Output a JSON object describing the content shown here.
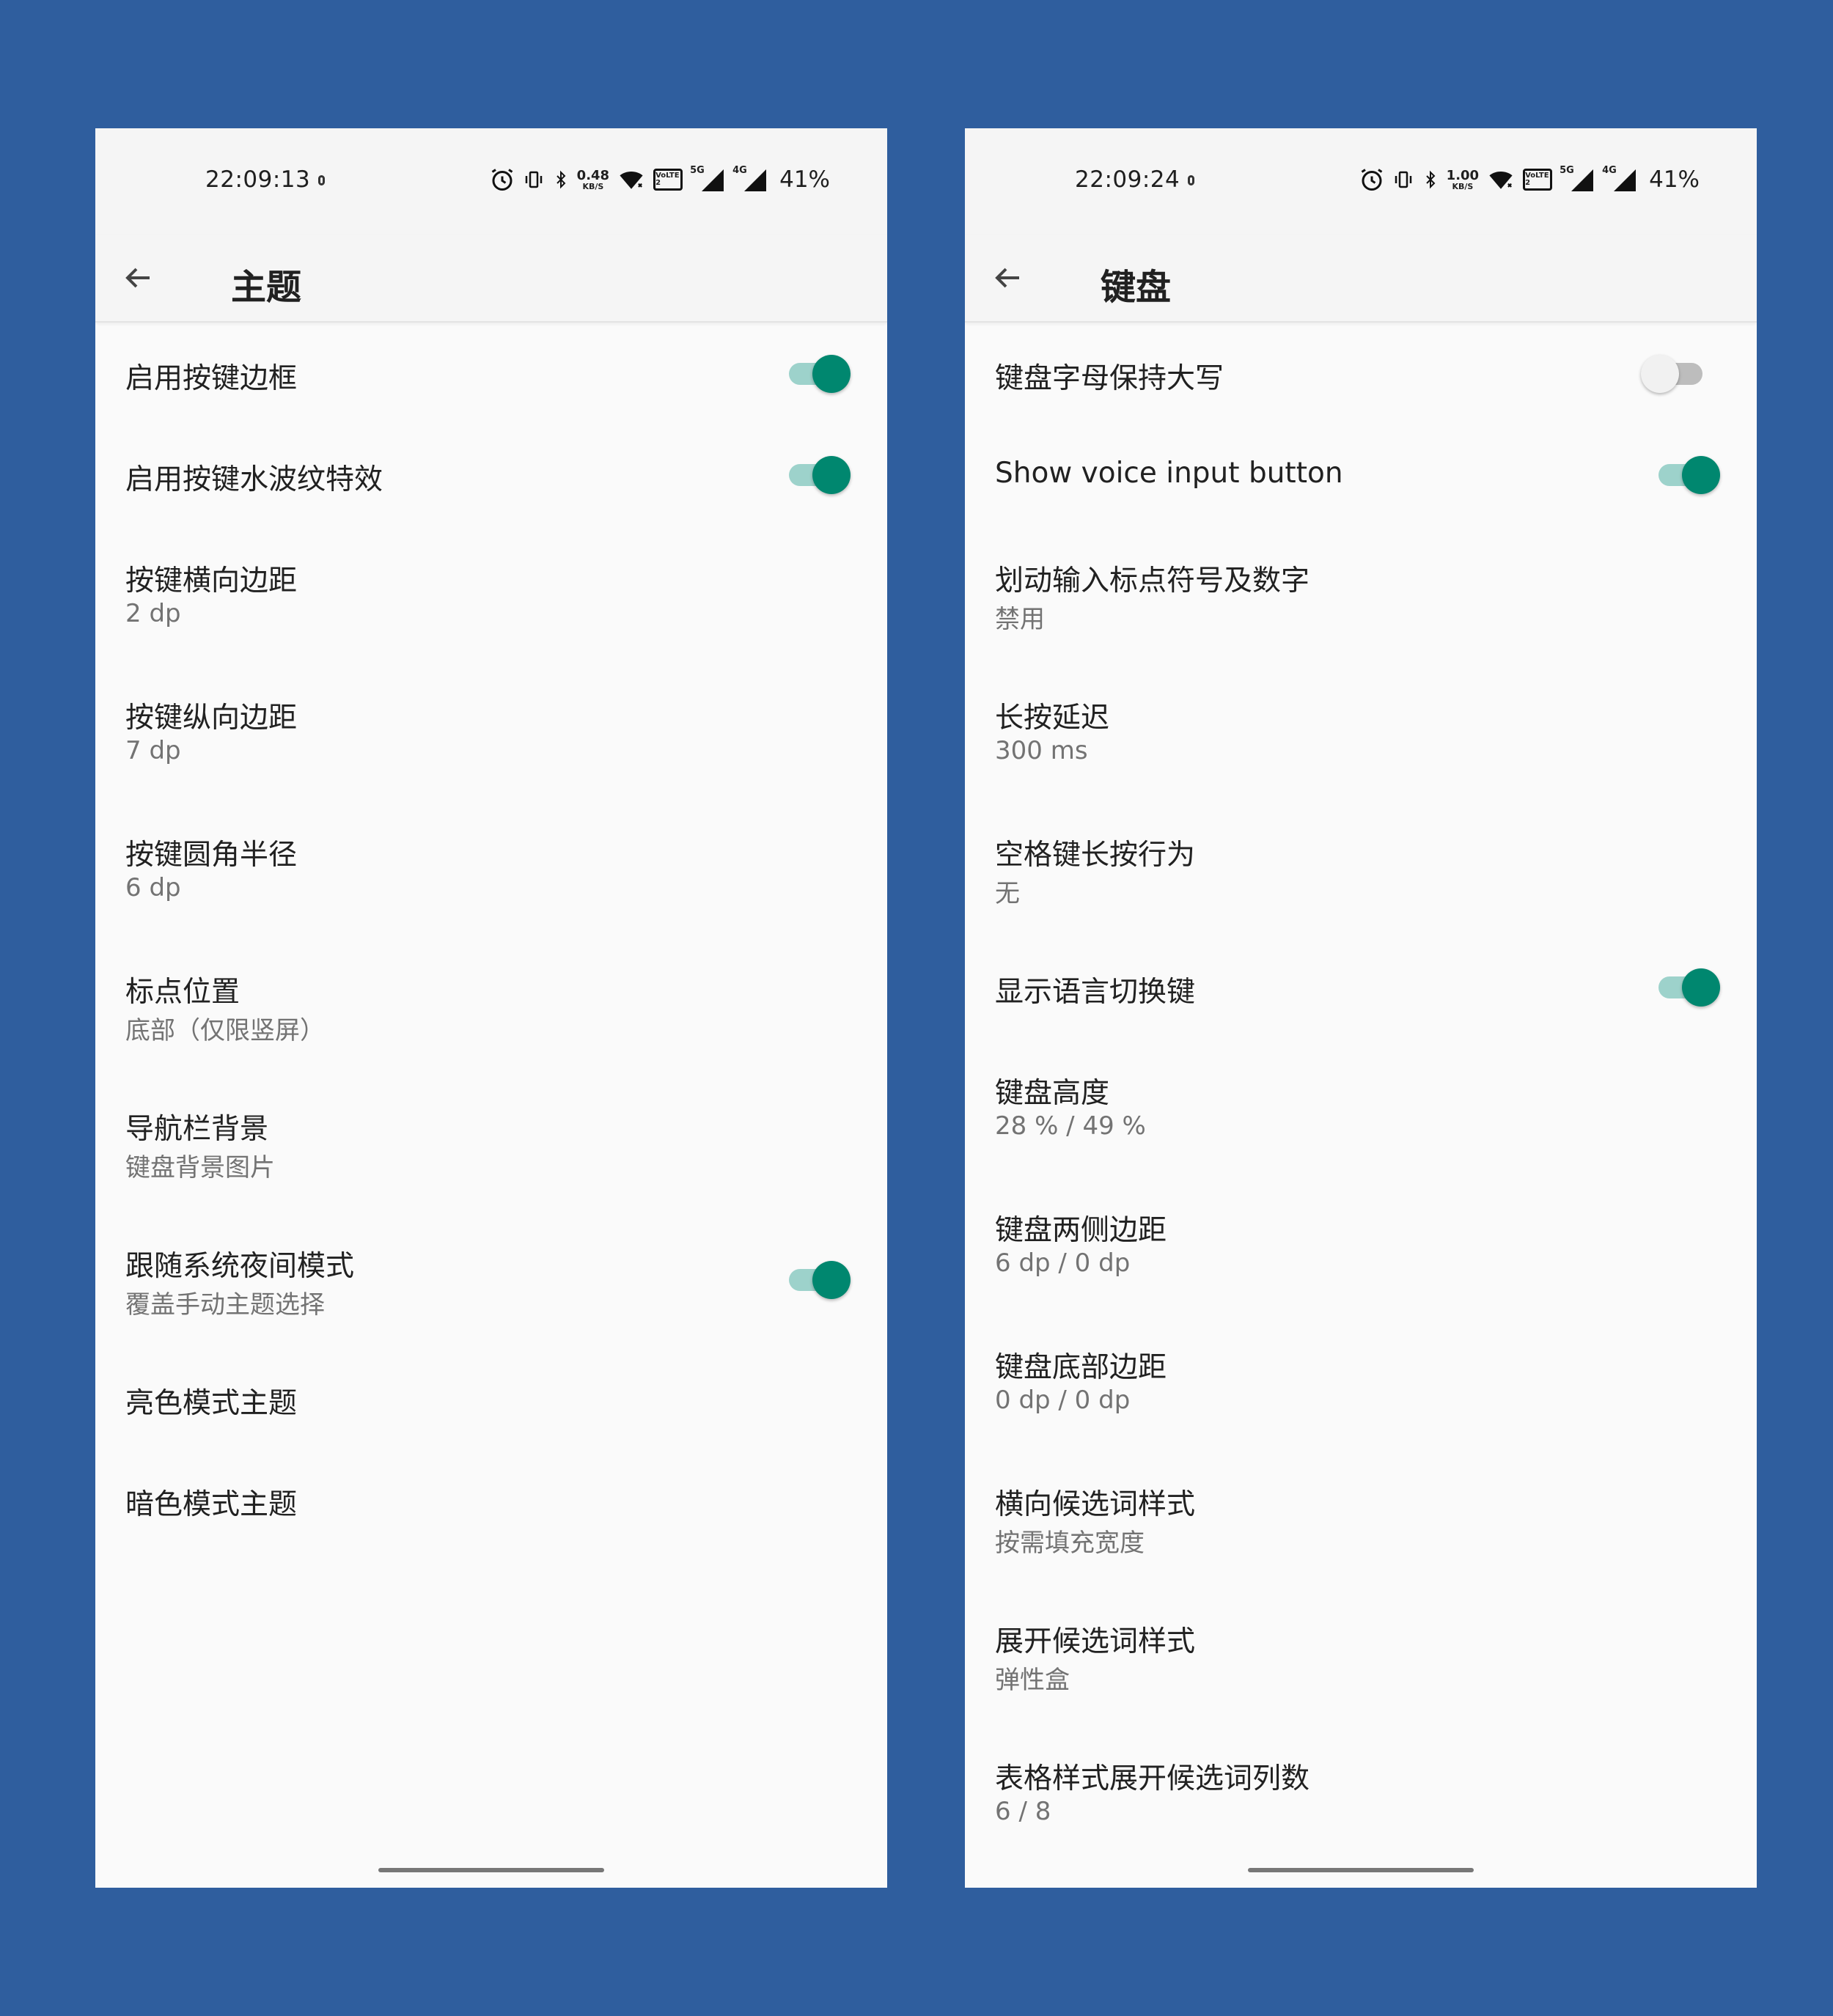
{
  "screens": [
    {
      "status": {
        "time": "22:09:13",
        "net_speed": "0.48",
        "net_unit": "KB/S",
        "volte": "VoLTE 2",
        "sig1": "5G",
        "sig2": "4G",
        "battery": "41%"
      },
      "title": "主题",
      "items": [
        {
          "title": "启用按键边框",
          "toggle": "on"
        },
        {
          "title": "启用按键水波纹特效",
          "toggle": "on"
        },
        {
          "title": "按键横向边距",
          "summary": "2 dp"
        },
        {
          "title": "按键纵向边距",
          "summary": "7 dp"
        },
        {
          "title": "按键圆角半径",
          "summary": "6 dp"
        },
        {
          "title": "标点位置",
          "summary": "底部（仅限竖屏）"
        },
        {
          "title": "导航栏背景",
          "summary": "键盘背景图片"
        },
        {
          "title": "跟随系统夜间模式",
          "summary": "覆盖手动主题选择",
          "toggle": "on"
        },
        {
          "title": "亮色模式主题"
        },
        {
          "title": "暗色模式主题"
        }
      ]
    },
    {
      "status": {
        "time": "22:09:24",
        "net_speed": "1.00",
        "net_unit": "KB/S",
        "volte": "VoLTE 2",
        "sig1": "5G",
        "sig2": "4G",
        "battery": "41%"
      },
      "title": "键盘",
      "items": [
        {
          "title": "键盘字母保持大写",
          "toggle": "off"
        },
        {
          "title": "Show voice input button",
          "toggle": "on"
        },
        {
          "title": "划动输入标点符号及数字",
          "summary": "禁用"
        },
        {
          "title": "长按延迟",
          "summary": "300 ms"
        },
        {
          "title": "空格键长按行为",
          "summary": "无"
        },
        {
          "title": "显示语言切换键",
          "toggle": "on"
        },
        {
          "title": "键盘高度",
          "summary": "28 % / 49 %"
        },
        {
          "title": "键盘两侧边距",
          "summary": "6 dp / 0 dp"
        },
        {
          "title": "键盘底部边距",
          "summary": "0 dp / 0 dp"
        },
        {
          "title": "横向候选词样式",
          "summary": "按需填充宽度"
        },
        {
          "title": "展开候选词样式",
          "summary": "弹性盒"
        },
        {
          "title": "表格样式展开候选词列数",
          "summary": "6  / 8"
        }
      ]
    }
  ],
  "colors": {
    "background": "#2F5E9E",
    "accent": "#00876F",
    "accent_track": "#9DD2CB",
    "text_primary": "#212121",
    "text_secondary": "#737373"
  },
  "icons": [
    "arrow-back-icon",
    "alarm-icon",
    "vibrate-icon",
    "bluetooth-icon",
    "wifi-icon",
    "signal-icon"
  ]
}
